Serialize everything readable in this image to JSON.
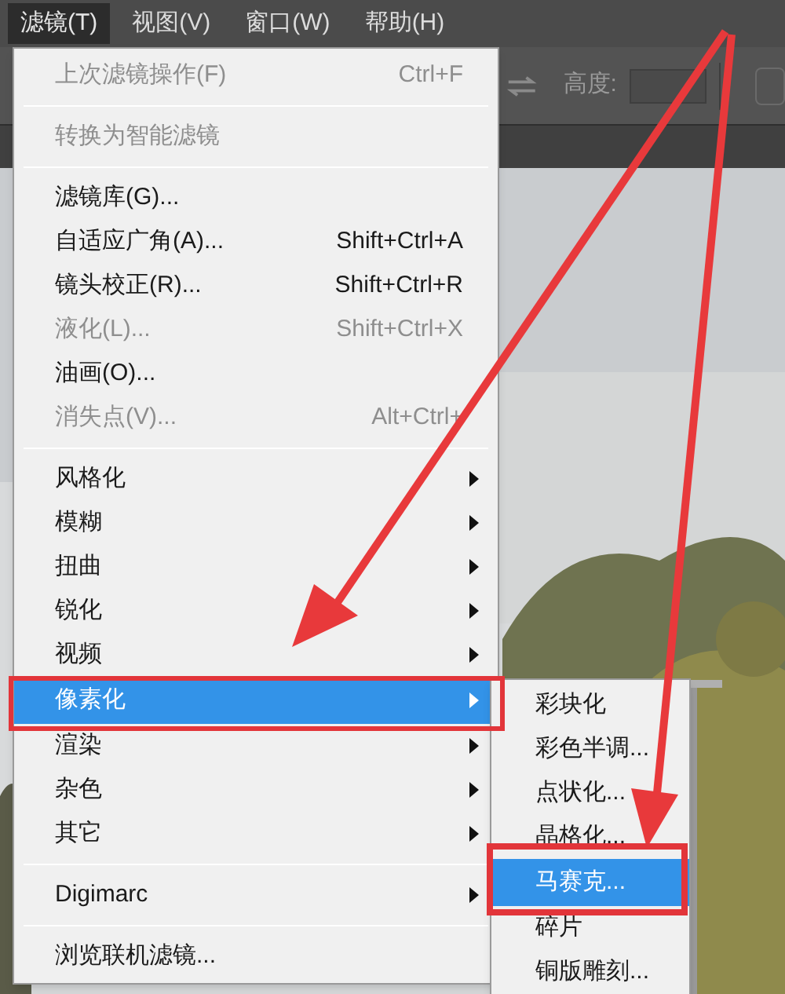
{
  "menu_bar": [
    {
      "label": "滤镜(T)",
      "selected": true
    },
    {
      "label": "视图(V)",
      "selected": false
    },
    {
      "label": "窗口(W)",
      "selected": false
    },
    {
      "label": "帮助(H)",
      "selected": false
    }
  ],
  "options_bar": {
    "height_label": "高度:"
  },
  "filter_menu": [
    {
      "kind": "item",
      "label": "上次滤镜操作(F)",
      "shortcut": "Ctrl+F",
      "disabled": true,
      "submenu": false,
      "selected": false
    },
    {
      "kind": "separator"
    },
    {
      "kind": "item",
      "label": "转换为智能滤镜",
      "disabled": true,
      "submenu": false,
      "selected": false
    },
    {
      "kind": "separator"
    },
    {
      "kind": "item",
      "label": "滤镜库(G)...",
      "disabled": false,
      "submenu": false,
      "selected": false
    },
    {
      "kind": "item",
      "label": "自适应广角(A)...",
      "shortcut": "Shift+Ctrl+A",
      "disabled": false,
      "submenu": false,
      "selected": false
    },
    {
      "kind": "item",
      "label": "镜头校正(R)...",
      "shortcut": "Shift+Ctrl+R",
      "disabled": false,
      "submenu": false,
      "selected": false
    },
    {
      "kind": "item",
      "label": "液化(L)...",
      "shortcut": "Shift+Ctrl+X",
      "disabled": true,
      "submenu": false,
      "selected": false
    },
    {
      "kind": "item",
      "label": "油画(O)...",
      "disabled": false,
      "submenu": false,
      "selected": false
    },
    {
      "kind": "item",
      "label": "消失点(V)...",
      "shortcut": "Alt+Ctrl+",
      "disabled": true,
      "submenu": false,
      "selected": false
    },
    {
      "kind": "separator"
    },
    {
      "kind": "item",
      "label": "风格化",
      "disabled": false,
      "submenu": true,
      "selected": false
    },
    {
      "kind": "item",
      "label": "模糊",
      "disabled": false,
      "submenu": true,
      "selected": false
    },
    {
      "kind": "item",
      "label": "扭曲",
      "disabled": false,
      "submenu": true,
      "selected": false
    },
    {
      "kind": "item",
      "label": "锐化",
      "disabled": false,
      "submenu": true,
      "selected": false
    },
    {
      "kind": "item",
      "label": "视频",
      "disabled": false,
      "submenu": true,
      "selected": false
    },
    {
      "kind": "item",
      "label": "像素化",
      "disabled": false,
      "submenu": true,
      "selected": true
    },
    {
      "kind": "item",
      "label": "渲染",
      "disabled": false,
      "submenu": true,
      "selected": false
    },
    {
      "kind": "item",
      "label": "杂色",
      "disabled": false,
      "submenu": true,
      "selected": false
    },
    {
      "kind": "item",
      "label": "其它",
      "disabled": false,
      "submenu": true,
      "selected": false
    },
    {
      "kind": "separator"
    },
    {
      "kind": "item",
      "label": "Digimarc",
      "disabled": false,
      "submenu": true,
      "selected": false
    },
    {
      "kind": "separator"
    },
    {
      "kind": "item",
      "label": "浏览联机滤镜...",
      "disabled": false,
      "submenu": false,
      "selected": false
    }
  ],
  "pixelate_submenu": [
    {
      "label": "彩块化",
      "selected": false
    },
    {
      "label": "彩色半调...",
      "selected": false
    },
    {
      "label": "点状化...",
      "selected": false
    },
    {
      "label": "晶格化...",
      "selected": false
    },
    {
      "label": "马赛克...",
      "selected": true
    },
    {
      "label": "碎片",
      "selected": false
    },
    {
      "label": "铜版雕刻...",
      "selected": false
    }
  ]
}
